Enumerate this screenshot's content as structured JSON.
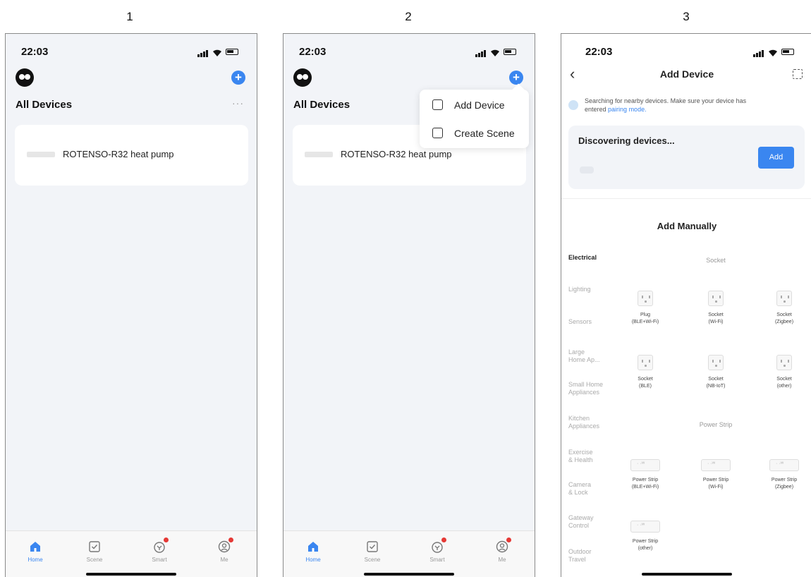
{
  "steps": [
    "1",
    "2",
    "3"
  ],
  "status": {
    "time": "22:03"
  },
  "home": {
    "section_title": "All Devices",
    "more_label": "···",
    "plus_label": "+",
    "device_name": "ROTENSO-R32 heat pump"
  },
  "tabs": [
    {
      "label": "Home",
      "icon": "home-icon"
    },
    {
      "label": "Scene",
      "icon": "scene-icon"
    },
    {
      "label": "Smart",
      "icon": "smart-icon"
    },
    {
      "label": "Me",
      "icon": "me-icon"
    }
  ],
  "popup": {
    "items": [
      {
        "label": "Add Device",
        "icon": "add-device-icon"
      },
      {
        "label": "Create Scene",
        "icon": "create-scene-icon"
      }
    ]
  },
  "add_device": {
    "back": "‹",
    "title": "Add Device",
    "search_text_1": "Searching for nearby devices. Make sure your device has",
    "search_text_2": "entered",
    "search_link": "pairing mode.",
    "discovering": "Discovering devices...",
    "add_button": "Add",
    "add_manually": "Add Manually",
    "categories": [
      "Electrical",
      "Lighting",
      "Sensors",
      "Large\nHome Ap...",
      "Small Home\nAppliances",
      "Kitchen\nAppliances",
      "Exercise\n& Health",
      "Camera\n& Lock",
      "Gateway\nControl",
      "Outdoor\nTravel"
    ],
    "section_socket": "Socket",
    "section_strip": "Power Strip",
    "sockets": [
      {
        "name": "Plug",
        "sub": "(BLE+Wi-Fi)"
      },
      {
        "name": "Socket",
        "sub": "(Wi-Fi)"
      },
      {
        "name": "Socket",
        "sub": "(Zigbee)"
      },
      {
        "name": "Socket",
        "sub": "(BLE)"
      },
      {
        "name": "Socket",
        "sub": "(NB-IoT)"
      },
      {
        "name": "Socket",
        "sub": "(other)"
      }
    ],
    "strips": [
      {
        "name": "Power Strip",
        "sub": "(BLE+Wi-Fi)"
      },
      {
        "name": "Power Strip",
        "sub": "(Wi-Fi)"
      },
      {
        "name": "Power Strip",
        "sub": "(Zigbee)"
      },
      {
        "name": "Power Strip",
        "sub": "(other)"
      }
    ]
  }
}
